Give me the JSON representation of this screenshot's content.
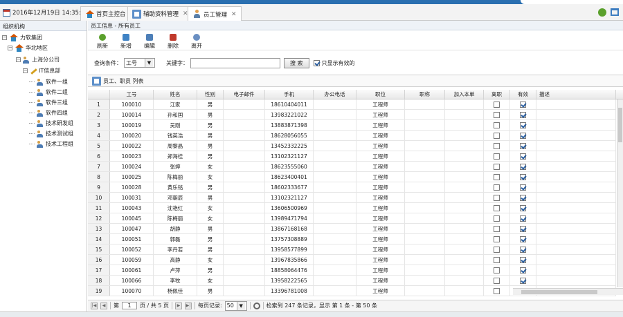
{
  "topbar": {
    "datetime": "2016年12月19日 14:35:01",
    "tabs": [
      {
        "label": "首页主控台",
        "closable": false
      },
      {
        "label": "辅助资料管理",
        "closable": true
      },
      {
        "label": "员工管理",
        "closable": true
      }
    ]
  },
  "sidebar": {
    "title": "组织机构",
    "tree": [
      {
        "label": "力软集团"
      },
      {
        "label": "华北地区"
      },
      {
        "label": "上海分公司"
      },
      {
        "label": "IT信息部"
      },
      {
        "label": "软件一组"
      },
      {
        "label": "软件二组"
      },
      {
        "label": "软件三组"
      },
      {
        "label": "软件四组"
      },
      {
        "label": "技术研发组"
      },
      {
        "label": "技术测试组"
      },
      {
        "label": "技术工程组"
      }
    ]
  },
  "main": {
    "breadcrumb": "员工信息 - 所有员工",
    "toolbar": [
      "刷新",
      "新增",
      "编辑",
      "删除",
      "离开"
    ],
    "search": {
      "condition_label": "查询条件：",
      "condition_value": "工号",
      "keyword_label": "关键字：",
      "keyword_value": "",
      "search_button": "搜 索",
      "only_valid_label": "只显示有效的",
      "only_valid_checked": true
    },
    "list_title": "员工、职员 列表",
    "columns": [
      "工号",
      "姓名",
      "性别",
      "电子邮件",
      "手机",
      "办公电话",
      "职位",
      "职称",
      "加入本单",
      "离职",
      "有效",
      "描述"
    ],
    "rows": [
      {
        "no": "1",
        "id": "100010",
        "name": "江家",
        "sex": "男",
        "phone": "18610404011",
        "title": "工程师",
        "left": false,
        "valid": true
      },
      {
        "no": "2",
        "id": "100014",
        "name": "孙和国",
        "sex": "男",
        "phone": "13983221022",
        "title": "工程师",
        "left": false,
        "valid": true
      },
      {
        "no": "3",
        "id": "100019",
        "name": "吴刚",
        "sex": "男",
        "phone": "13883871398",
        "title": "工程师",
        "left": false,
        "valid": true
      },
      {
        "no": "4",
        "id": "100020",
        "name": "钱英浩",
        "sex": "男",
        "phone": "18628056055",
        "title": "工程师",
        "left": false,
        "valid": true
      },
      {
        "no": "5",
        "id": "100022",
        "name": "周黎晶",
        "sex": "男",
        "phone": "13452332225",
        "title": "工程师",
        "left": false,
        "valid": true
      },
      {
        "no": "6",
        "id": "100023",
        "name": "郑海桂",
        "sex": "男",
        "phone": "13102321127",
        "title": "工程师",
        "left": false,
        "valid": true
      },
      {
        "no": "7",
        "id": "100024",
        "name": "张婷",
        "sex": "女",
        "phone": "18623555060",
        "title": "工程师",
        "left": false,
        "valid": true
      },
      {
        "no": "8",
        "id": "100025",
        "name": "陈梅丽",
        "sex": "女",
        "phone": "18623400401",
        "title": "工程师",
        "left": false,
        "valid": true
      },
      {
        "no": "9",
        "id": "100028",
        "name": "黄乐铭",
        "sex": "男",
        "phone": "18602333677",
        "title": "工程师",
        "left": false,
        "valid": true
      },
      {
        "no": "10",
        "id": "100031",
        "name": "邓朝辰",
        "sex": "男",
        "phone": "13102321127",
        "title": "工程师",
        "left": false,
        "valid": true
      },
      {
        "no": "11",
        "id": "100043",
        "name": "沈艳红",
        "sex": "女",
        "phone": "13606500969",
        "title": "工程师",
        "left": false,
        "valid": true
      },
      {
        "no": "12",
        "id": "100045",
        "name": "陈梅丽",
        "sex": "女",
        "phone": "13989471794",
        "title": "工程师",
        "left": false,
        "valid": true
      },
      {
        "no": "13",
        "id": "100047",
        "name": "胡静",
        "sex": "男",
        "phone": "13867168168",
        "title": "工程师",
        "left": false,
        "valid": true
      },
      {
        "no": "14",
        "id": "100051",
        "name": "郭磊",
        "sex": "男",
        "phone": "13757308889",
        "title": "工程师",
        "left": false,
        "valid": true
      },
      {
        "no": "15",
        "id": "100052",
        "name": "李丹若",
        "sex": "男",
        "phone": "13958577899",
        "title": "工程师",
        "left": false,
        "valid": true
      },
      {
        "no": "16",
        "id": "100059",
        "name": "高静",
        "sex": "女",
        "phone": "13967835866",
        "title": "工程师",
        "left": false,
        "valid": true
      },
      {
        "no": "17",
        "id": "100061",
        "name": "卢萍",
        "sex": "男",
        "phone": "18858064476",
        "title": "工程师",
        "left": false,
        "valid": true
      },
      {
        "no": "18",
        "id": "100066",
        "name": "李牧",
        "sex": "女",
        "phone": "13958222565",
        "title": "工程师",
        "left": false,
        "valid": true
      },
      {
        "no": "19",
        "id": "100070",
        "name": "杨佩佳",
        "sex": "男",
        "phone": "13396781008",
        "title": "工程师",
        "left": false,
        "valid": true
      }
    ],
    "pager": {
      "page_prefix": "第",
      "page_value": "1",
      "page_suffix": "页 / 共 5 页",
      "per_page_label": "每页记录:",
      "per_page_value": "50",
      "summary": "检索到 247 条记录，显示 第 1 条 - 第 50 条"
    }
  }
}
